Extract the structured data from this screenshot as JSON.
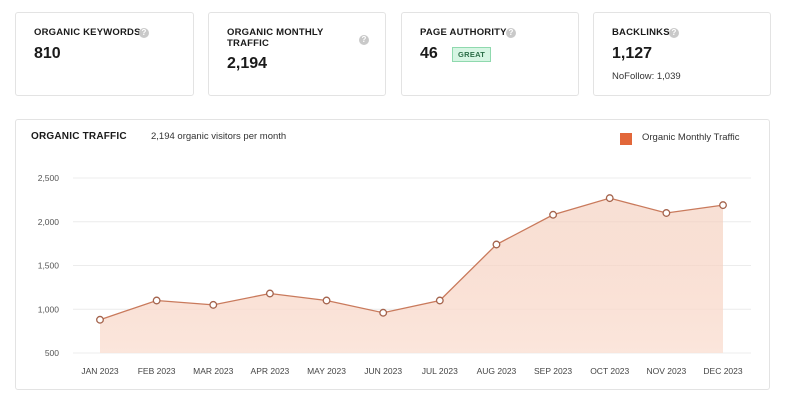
{
  "cards": [
    {
      "label": "ORGANIC KEYWORDS",
      "value": "810"
    },
    {
      "label": "ORGANIC MONTHLY TRAFFIC",
      "value": "2,194"
    },
    {
      "label": "PAGE AUTHORITY",
      "value": "46",
      "badge": "GREAT"
    },
    {
      "label": "BACKLINKS",
      "value": "1,127",
      "sub": "NoFollow: 1,039"
    }
  ],
  "help_glyph": "?",
  "colors": {
    "accent": "#e2673a",
    "line": "#c97a5c",
    "badge_bg": "#d6f5e3"
  },
  "chart_data": {
    "type": "area",
    "title": "ORGANIC TRAFFIC",
    "subtitle": "2,194 organic visitors per month",
    "series": [
      {
        "name": "Organic Monthly Traffic",
        "values": [
          880,
          1100,
          1050,
          1180,
          1100,
          960,
          1100,
          1740,
          2080,
          2270,
          2100,
          2190
        ]
      }
    ],
    "categories": [
      "JAN 2023",
      "FEB 2023",
      "MAR 2023",
      "APR 2023",
      "MAY 2023",
      "JUN 2023",
      "JUL 2023",
      "AUG 2023",
      "SEP 2023",
      "OCT 2023",
      "NOV 2023",
      "DEC 2023"
    ],
    "y_ticks": [
      "2,500",
      "2,000",
      "1,500",
      "1,000",
      "500"
    ],
    "ylim": [
      500,
      2500
    ],
    "grid": true,
    "legend": "top-right"
  }
}
